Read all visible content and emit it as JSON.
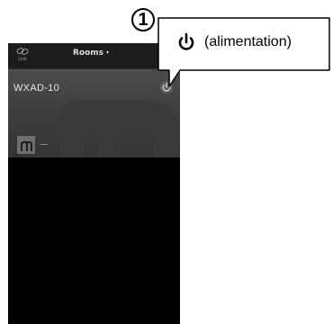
{
  "nav": {
    "link_label": "Link",
    "rooms_label": "Rooms",
    "rooms_caret": "▾"
  },
  "device": {
    "name": "WXAD-10",
    "track_placeholder": "—"
  },
  "callout": {
    "number": "1",
    "text": "(alimentation)"
  },
  "icons": {
    "link": "link-icon",
    "power": "power-icon",
    "dropdown": "chevron-down-icon",
    "brand": "brand-m-logo"
  },
  "colors": {
    "nav_background": "#1c1c1c",
    "hero_background": "#474747",
    "screen_background": "#000000"
  }
}
